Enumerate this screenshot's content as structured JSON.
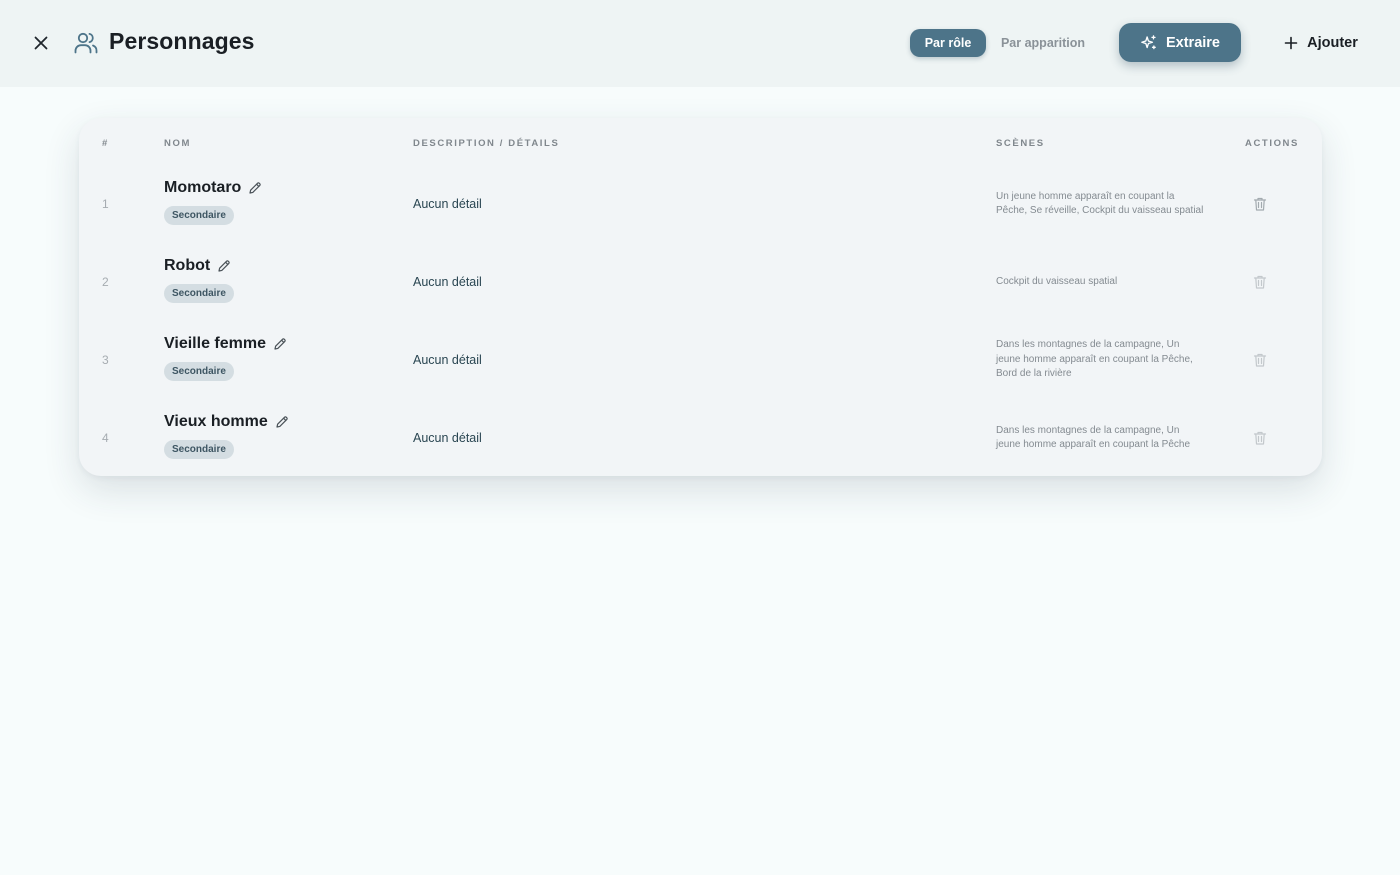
{
  "header": {
    "title": "Personnages",
    "close_icon": "close-icon",
    "title_icon": "users-icon",
    "view_toggle": {
      "by_role": "Par rôle",
      "by_appearance": "Par apparition",
      "active": "by_role"
    },
    "extract_label": "Extraire",
    "extract_icon": "sparkles-icon",
    "add_label": "Ajouter",
    "add_icon": "plus-icon"
  },
  "colors": {
    "accent": "#4d7489",
    "header_bg": "#eef4f4",
    "page_bg": "#f7fcfc",
    "card_bg": "#f2f5f7",
    "badge_bg": "#d4dde2"
  },
  "table": {
    "columns": {
      "num": "#",
      "name": "Nom",
      "description": "Description / Détails",
      "scenes": "Scènes",
      "actions": "Actions"
    },
    "rows": [
      {
        "num": "1",
        "name": "Momotaro",
        "role": "Secondaire",
        "description": "Aucun détail",
        "scenes": "Un jeune homme apparaît en coupant la Pêche, Se réveille, Cockpit du vaisseau spatial"
      },
      {
        "num": "2",
        "name": "Robot",
        "role": "Secondaire",
        "description": "Aucun détail",
        "scenes": "Cockpit du vaisseau spatial"
      },
      {
        "num": "3",
        "name": "Vieille femme",
        "role": "Secondaire",
        "description": "Aucun détail",
        "scenes": "Dans les montagnes de la campagne, Un jeune homme apparaît en coupant la Pêche, Bord de la rivière"
      },
      {
        "num": "4",
        "name": "Vieux homme",
        "role": "Secondaire",
        "description": "Aucun détail",
        "scenes": "Dans les montagnes de la campagne, Un jeune homme apparaît en coupant la Pêche"
      }
    ]
  }
}
